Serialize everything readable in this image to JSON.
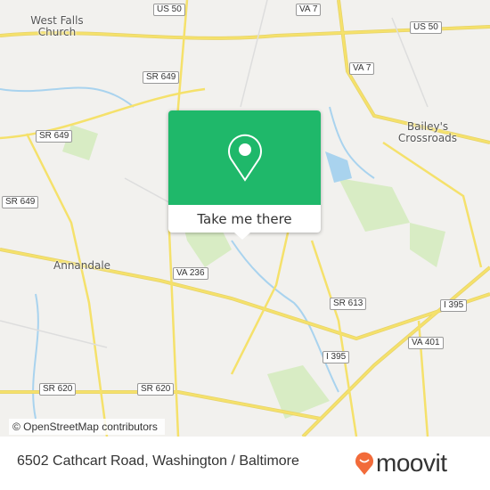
{
  "map": {
    "places": [
      "West Falls Church",
      "Bailey's Crossroads",
      "Annandale"
    ],
    "shields": [
      "US 50",
      "US 50",
      "VA 7",
      "VA 7",
      "SR 649",
      "SR 649",
      "SR 649",
      "VA 236",
      "SR 613",
      "I 395",
      "I 395",
      "VA 401",
      "SR 620",
      "SR 620"
    ],
    "colors": {
      "background": "#f2f1ee",
      "road": "#f5e16b",
      "water": "#a9d3ee",
      "park": "#d8ecc4"
    }
  },
  "popup": {
    "icon": "map-pin-icon",
    "button_label": "Take me there",
    "color": "#1fb86a"
  },
  "attribution": "© OpenStreetMap contributors",
  "footer": {
    "address": "6502 Cathcart Road, Washington / Baltimore",
    "brand": "moovit",
    "brand_color": "#f26b3a"
  }
}
